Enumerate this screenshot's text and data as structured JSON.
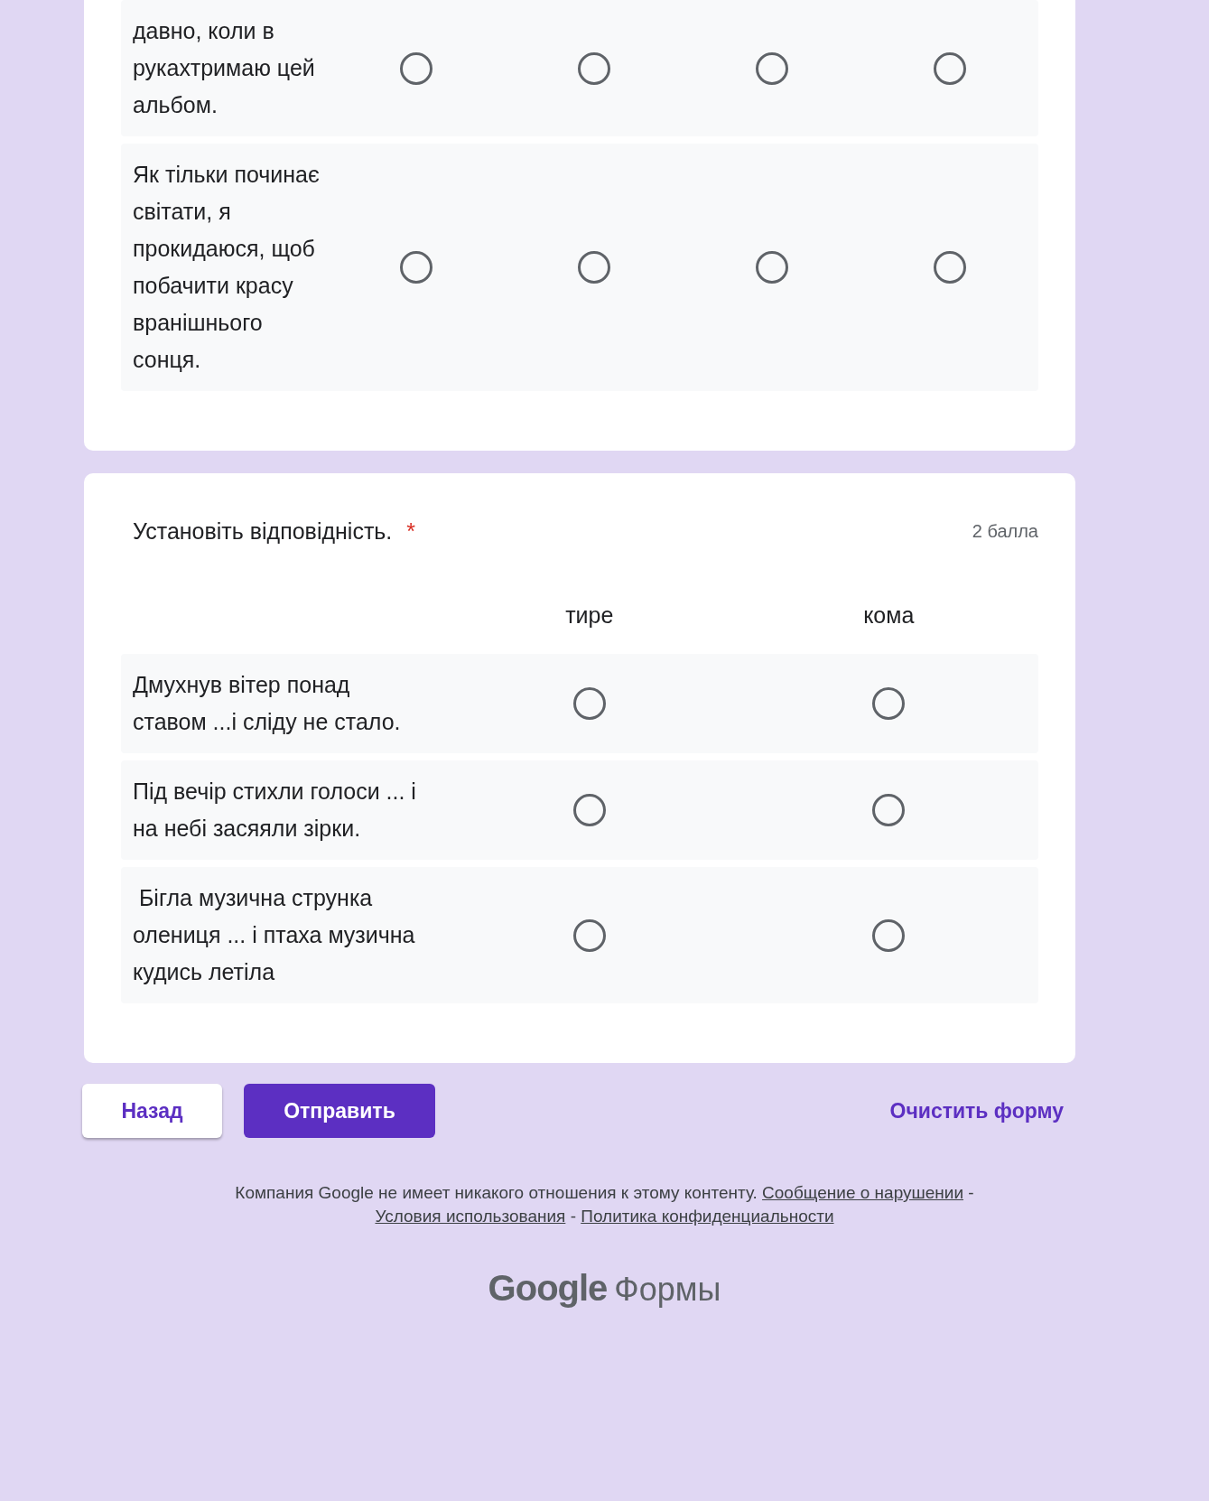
{
  "cards": [
    {
      "rows": [
        {
          "label": "давно, коли в рукахтримаю цей альбом.",
          "options": [
            {
              "selected": false
            },
            {
              "selected": false
            },
            {
              "selected": false
            },
            {
              "selected": false
            }
          ]
        },
        {
          "label": "Як тільки починає світати, я прокидаюся, щоб побачити красу вранішнього сонця.",
          "options": [
            {
              "selected": false
            },
            {
              "selected": false
            },
            {
              "selected": false
            },
            {
              "selected": false
            }
          ]
        }
      ]
    },
    {
      "title": "Установіть відповідність.",
      "required_marker": "*",
      "points": "2 балла",
      "columns": [
        "тире",
        "кома"
      ],
      "rows": [
        {
          "label": "Дмухнув вітер понад ставом ...і сліду не стало.",
          "options": [
            {
              "selected": false
            },
            {
              "selected": false
            }
          ]
        },
        {
          "label": "Під вечір стихли голоси ... і на небі засяяли зірки.",
          "options": [
            {
              "selected": false
            },
            {
              "selected": false
            }
          ]
        },
        {
          "label": " Бігла музична струнка олениця ... і птаха музична  кудись летіла",
          "options": [
            {
              "selected": false
            },
            {
              "selected": false
            }
          ]
        }
      ]
    }
  ],
  "buttons": {
    "back": "Назад",
    "submit": "Отправить",
    "clear": "Очистить форму"
  },
  "footer": {
    "text": "Компания Google не имеет никакого отношения к этому контенту.",
    "links": [
      "Сообщение о нарушении",
      "Условия использования",
      "Политика конфиденциальности"
    ],
    "separator": "-"
  },
  "logo": {
    "brand": "Google",
    "product": "Формы"
  }
}
